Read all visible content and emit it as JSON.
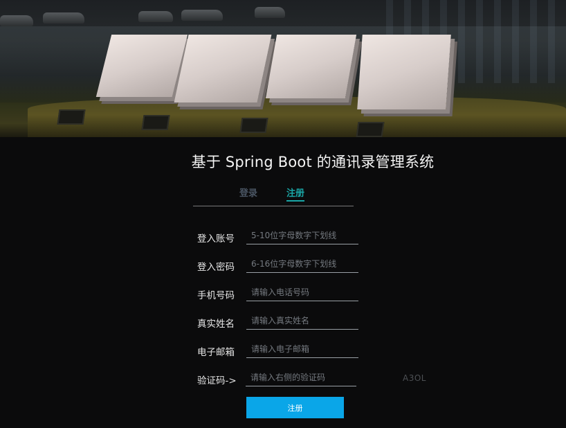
{
  "header": {
    "title": "基于 Spring Boot 的通讯录管理系统"
  },
  "tabs": [
    {
      "label": "登录",
      "active": false
    },
    {
      "label": "注册",
      "active": true
    }
  ],
  "form": {
    "fields": [
      {
        "label": "登入账号",
        "placeholder": "5-10位字母数字下划线",
        "value": ""
      },
      {
        "label": "登入密码",
        "placeholder": "6-16位字母数字下划线",
        "value": ""
      },
      {
        "label": "手机号码",
        "placeholder": "请输入电话号码",
        "value": ""
      },
      {
        "label": "真实姓名",
        "placeholder": "请输入真实姓名",
        "value": ""
      },
      {
        "label": "电子邮箱",
        "placeholder": "请输入电子邮箱",
        "value": ""
      },
      {
        "label": "验证码->",
        "placeholder": "请输入右侧的验证码",
        "value": ""
      }
    ],
    "captcha_text": "A3OL",
    "submit_label": "注册"
  },
  "colors": {
    "background": "#0b0b0c",
    "accent_tab": "#1aa6a6",
    "submit_button": "#0aa6e8"
  }
}
